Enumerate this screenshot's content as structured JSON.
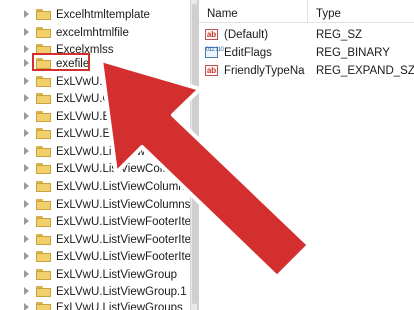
{
  "tree": {
    "items": [
      {
        "label": "Excelhtmltemplate"
      },
      {
        "label": "excelmhtmlfile"
      },
      {
        "label": "Excelxmlss"
      },
      {
        "label": "exefile"
      },
      {
        "label": "ExLVwU.Co"
      },
      {
        "label": "ExLVwU.Contr"
      },
      {
        "label": "ExLVwU.ExplorerBa"
      },
      {
        "label": "ExLVwU.ExplorerLis"
      },
      {
        "label": "ExLVwU.ListViewColu"
      },
      {
        "label": "ExLVwU.ListViewColumn"
      },
      {
        "label": "ExLVwU.ListViewColumns"
      },
      {
        "label": "ExLVwU.ListViewColumns"
      },
      {
        "label": "ExLVwU.ListViewFooterIter"
      },
      {
        "label": "ExLVwU.ListViewFooterIter"
      },
      {
        "label": "ExLVwU.ListViewFooterIter"
      },
      {
        "label": "ExLVwU.ListViewGroup"
      },
      {
        "label": "ExLVwU.ListViewGroup.1"
      },
      {
        "label": "ExLVwU.ListViewGroups"
      }
    ],
    "selected_label": "exefile"
  },
  "values_pane": {
    "columns": {
      "name": "Name",
      "type": "Type"
    },
    "rows": [
      {
        "icon": "string-value-icon",
        "icon_text": "ab",
        "name": "(Default)",
        "type": "REG_SZ"
      },
      {
        "icon": "binary-value-icon",
        "icon_text": "011 110",
        "name": "EditFlags",
        "type": "REG_BINARY"
      },
      {
        "icon": "string-value-icon",
        "icon_text": "ab",
        "name": "FriendlyTypeNa",
        "type": "REG_EXPAND_SZ"
      }
    ]
  },
  "colors": {
    "highlight_red": "#d32f2f",
    "folder_yellow": "#f1cf6b"
  }
}
